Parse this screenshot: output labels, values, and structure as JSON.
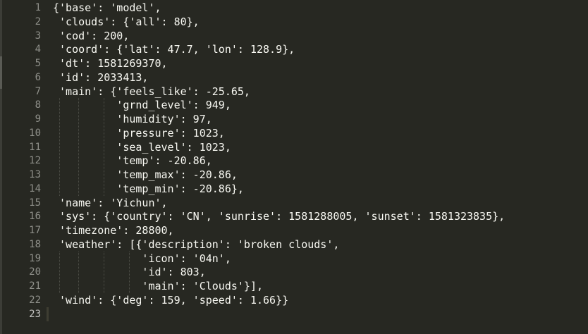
{
  "editor": {
    "current_line": 23,
    "lines": [
      {
        "number": "1",
        "text": "{'base': 'model',"
      },
      {
        "number": "2",
        "text": " 'clouds': {'all': 80},"
      },
      {
        "number": "3",
        "text": " 'cod': 200,"
      },
      {
        "number": "4",
        "text": " 'coord': {'lat': 47.7, 'lon': 128.9},"
      },
      {
        "number": "5",
        "text": " 'dt': 1581269370,"
      },
      {
        "number": "6",
        "text": " 'id': 2033413,"
      },
      {
        "number": "7",
        "text": " 'main': {'feels_like': -25.65,"
      },
      {
        "number": "8",
        "text": "          'grnd_level': 949,"
      },
      {
        "number": "9",
        "text": "          'humidity': 97,"
      },
      {
        "number": "10",
        "text": "          'pressure': 1023,"
      },
      {
        "number": "11",
        "text": "          'sea_level': 1023,"
      },
      {
        "number": "12",
        "text": "          'temp': -20.86,"
      },
      {
        "number": "13",
        "text": "          'temp_max': -20.86,"
      },
      {
        "number": "14",
        "text": "          'temp_min': -20.86},"
      },
      {
        "number": "15",
        "text": " 'name': 'Yichun',"
      },
      {
        "number": "16",
        "text": " 'sys': {'country': 'CN', 'sunrise': 1581288005, 'sunset': 1581323835},"
      },
      {
        "number": "17",
        "text": " 'timezone': 28800,"
      },
      {
        "number": "18",
        "text": " 'weather': [{'description': 'broken clouds',"
      },
      {
        "number": "19",
        "text": "              'icon': '04n',"
      },
      {
        "number": "20",
        "text": "              'id': 803,"
      },
      {
        "number": "21",
        "text": "              'main': 'Clouds'}],"
      },
      {
        "number": "22",
        "text": " 'wind': {'deg': 159, 'speed': 1.66}}"
      },
      {
        "number": "23",
        "text": ""
      }
    ]
  },
  "colors": {
    "background": "#272822",
    "text": "#f8f8f2",
    "line_number": "#8f908a",
    "current_line": "#3e3d32"
  }
}
